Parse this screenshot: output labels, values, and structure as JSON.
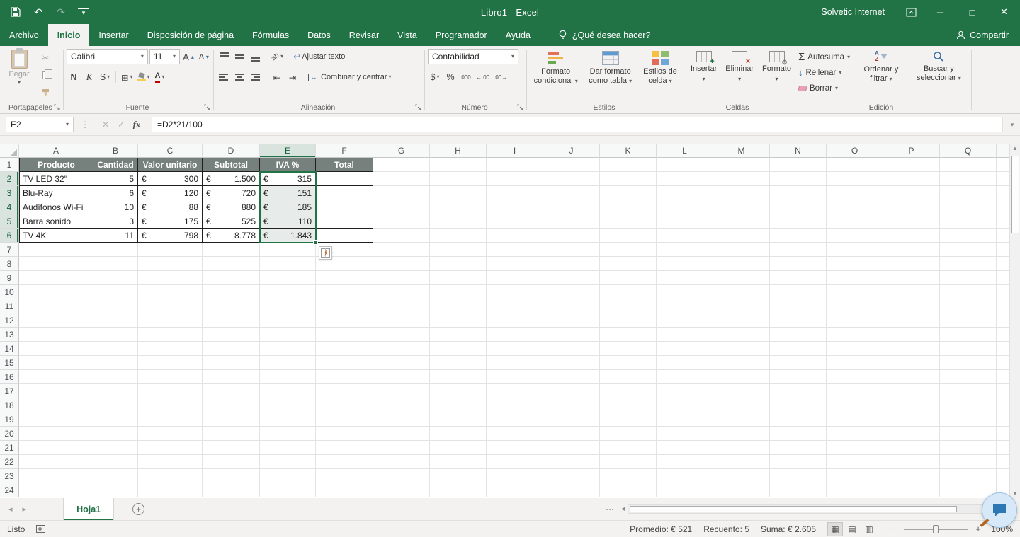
{
  "colors": {
    "excel_green": "#217346",
    "table_header_bg": "#76807d",
    "selection_fill": "#e7ebe9",
    "selection_border": "#217346"
  },
  "titlebar": {
    "title": "Libro1  -  Excel",
    "user": "Solvetic Internet"
  },
  "menu": {
    "tabs": [
      "Archivo",
      "Inicio",
      "Insertar",
      "Disposición de página",
      "Fórmulas",
      "Datos",
      "Revisar",
      "Vista",
      "Programador",
      "Ayuda"
    ],
    "active_tab": "Inicio",
    "tell_me": "¿Qué desea hacer?",
    "share": "Compartir"
  },
  "ribbon": {
    "paste_label": "Pegar",
    "group_clipboard": "Portapapeles",
    "font_name": "Calibri",
    "font_size": "11",
    "bold_label": "N",
    "italic_label": "K",
    "underline_label": "S",
    "group_font": "Fuente",
    "wrap_text_label": "Ajustar texto",
    "merge_center_label": "Combinar y centrar",
    "group_alignment": "Alineación",
    "number_format": "Contabilidad",
    "currency_label": "$",
    "percent_label": "%",
    "thousands_label": "000",
    "group_number": "Número",
    "conditional_label": "Formato condicional",
    "format_table_label": "Dar formato como tabla",
    "cell_styles_label": "Estilos de celda",
    "group_styles": "Estilos",
    "insert_label": "Insertar",
    "delete_label": "Eliminar",
    "format_label": "Formato",
    "group_cells": "Celdas",
    "autosum_label": "Autosuma",
    "fill_label": "Rellenar",
    "clear_label": "Borrar",
    "sort_label": "Ordenar y filtrar",
    "find_label": "Buscar y seleccionar",
    "group_editing": "Edición"
  },
  "formula_bar": {
    "name_box": "E2",
    "fx": "fx",
    "formula": "=D2*21/100"
  },
  "grid": {
    "columns": [
      "A",
      "B",
      "C",
      "D",
      "E",
      "F",
      "G",
      "H",
      "I",
      "J",
      "K",
      "L",
      "M",
      "N",
      "O",
      "P",
      "Q"
    ],
    "row_count": 24,
    "selection": {
      "active_cell": "E2",
      "col": "E",
      "row_start": 2,
      "row_end": 6
    },
    "table": {
      "header_row": [
        "Producto",
        "Cantidad",
        "Valor unitario",
        "Subtotal",
        "IVA %",
        "Total"
      ],
      "data_rows": [
        [
          "TV LED 32\"",
          "5",
          [
            "€",
            "300"
          ],
          [
            "€",
            "1.500"
          ],
          [
            "€",
            "315"
          ],
          ""
        ],
        [
          "Blu-Ray",
          "6",
          [
            "€",
            "120"
          ],
          [
            "€",
            "720"
          ],
          [
            "€",
            "151"
          ],
          ""
        ],
        [
          "Audífonos Wi-Fi",
          "10",
          [
            "€",
            "88"
          ],
          [
            "€",
            "880"
          ],
          [
            "€",
            "185"
          ],
          ""
        ],
        [
          "Barra sonido",
          "3",
          [
            "€",
            "175"
          ],
          [
            "€",
            "525"
          ],
          [
            "€",
            "110"
          ],
          ""
        ],
        [
          "TV 4K",
          "11",
          [
            "€",
            "798"
          ],
          [
            "€",
            "8.778"
          ],
          [
            "€",
            "1.843"
          ],
          ""
        ]
      ]
    }
  },
  "sheet_bar": {
    "tabs": [
      {
        "label": "Hoja1",
        "active": true
      }
    ]
  },
  "status_bar": {
    "mode": "Listo",
    "aggregates": [
      {
        "label": "Promedio:",
        "value": "€ 521"
      },
      {
        "label": "Recuento:",
        "value": "5"
      },
      {
        "label": "Suma:",
        "value": "€ 2.605"
      }
    ],
    "zoom": "100%"
  }
}
